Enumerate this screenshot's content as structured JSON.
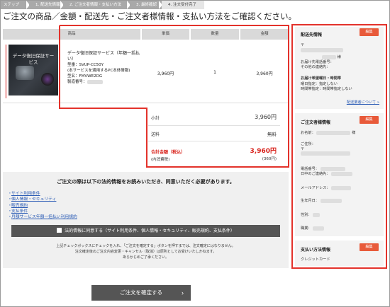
{
  "steps": [
    {
      "label": "ステップ"
    },
    {
      "label": "1. 配送先情報"
    },
    {
      "label": "2. ご注文者情報・支払い方法"
    },
    {
      "label": "3. 最終確認"
    },
    {
      "label": "4. 注文受付完了"
    }
  ],
  "page_title": "ご注文の商品／金額・配送先・ご注文者様情報・支払い方法をご確認ください。",
  "table": {
    "headers": {
      "product": "商品",
      "unit_price": "単価",
      "quantity": "数量",
      "amount": "金額"
    },
    "item": {
      "image_text": "データ復旧保証サービス",
      "name": "データ復旧保証サービス（年額一括払い）",
      "model_label": "型番：SVUP-CC50Y",
      "note": "(本サービスを適用するPC本体情報)",
      "product_model": "型名：FMVWE2DG",
      "serial": "製造番号：",
      "unit_price": "3,960円",
      "quantity": "1",
      "amount": "3,960円"
    }
  },
  "summary": {
    "subtotal_label": "小計",
    "subtotal_value": "3,960円",
    "shipping_label": "送料",
    "shipping_value": "無料",
    "total_label": "合計金額（税込）",
    "total_value": "3,960円",
    "tax_label": "(内消費税)",
    "tax_value": "(360円)"
  },
  "legal": {
    "title": "ご注文の際は以下の法的情報をお読みいただき、同意いただく必要があります。",
    "links": [
      "サイト利用条件",
      "個人情報・セキュリティ",
      "販売規約",
      "支払条件",
      "月額サービス年額一括払い利用規約"
    ],
    "agree_label": "法的情報に同意する（サイト利用条件、個人情報・セキュリティ、販売規約、支払条件）",
    "note_1": "上記チェックボックスにチェックを入れ、「ご注文を確定する」ボタンを押すまでは、注文確定にはなりません。",
    "note_2": "注文確定後のご注文内容変更・キャンセル（取消）は原則としてお受けいたしかねます。",
    "note_3": "あらかじめご了承ください。"
  },
  "confirm_button": "ご注文を確定する",
  "shipping_panel": {
    "title": "配送先情報",
    "edit": "編集",
    "postal_prefix": "〒",
    "honorific": "様",
    "contact_label": "お届け先電話番号：",
    "other_contact_label": "その他の連絡先：",
    "delivery_title": "お届け希望曜日・時間帯",
    "day_line": "曜日指定：指定しない",
    "time_line": "時間帯指定：時間帯指定しない",
    "link": "配送業者について »"
  },
  "orderer_panel": {
    "title": "ご注文者様情報",
    "edit": "編集",
    "name_label": "お名前：",
    "honorific": "様",
    "address_label": "ご住所：",
    "postal_prefix": "〒",
    "phone_label": "電話番号：",
    "day_contact_label": "日中のご連絡先：",
    "email_label": "メールアドレス：",
    "birth_label": "生年月日：",
    "gender_label": "性別：",
    "job_label": "職業："
  },
  "payment_panel": {
    "title": "支払い方法情報",
    "edit": "編集",
    "method": "クレジットカード"
  },
  "colors": {
    "highlight": "#e3322b",
    "edit_button": "#e85a3a",
    "total_red": "#d8221b",
    "link": "#2a5bb5"
  }
}
